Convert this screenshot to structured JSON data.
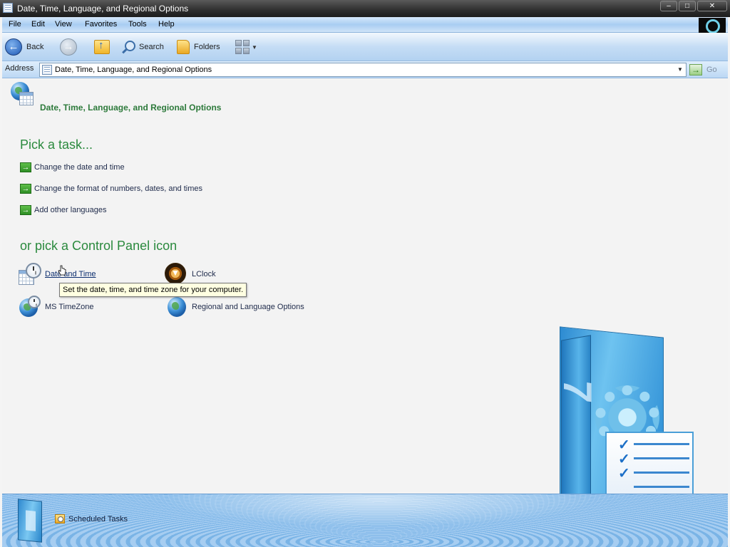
{
  "window": {
    "title": "Date, Time, Language, and Regional Options",
    "controls": {
      "minimize": "–",
      "maximize": "□",
      "close": "✕"
    }
  },
  "menu": [
    "File",
    "Edit",
    "View",
    "Favorites",
    "Tools",
    "Help"
  ],
  "toolbar": {
    "back_label": "Back",
    "search_label": "Search",
    "folders_label": "Folders"
  },
  "address": {
    "label": "Address",
    "value": "Date, Time, Language, and Regional Options",
    "go_label": "Go"
  },
  "page": {
    "title": "Date, Time, Language, and Regional Options",
    "task_heading": "Pick a task...",
    "tasks": [
      "Change the date and time",
      "Change the format of numbers, dates, and times",
      "Add other languages"
    ],
    "icon_heading": "or pick a Control Panel icon",
    "icons": [
      {
        "label": "Date and Time",
        "icon": "date-time-icon"
      },
      {
        "label": "LClock",
        "icon": "lclock-icon"
      },
      {
        "label": "MS TimeZone",
        "icon": "globe-clock-icon"
      },
      {
        "label": "Regional and Language Options",
        "icon": "globe-icon"
      }
    ],
    "tooltip": "Set the date, time, and time zone for your computer."
  },
  "details": {
    "link": "Scheduled Tasks"
  },
  "colors": {
    "heading_green": "#2b8a3e",
    "title_green": "#2d7a3b",
    "link_navy": "#0b2d6e",
    "tooltip_bg": "#ffffe1"
  }
}
